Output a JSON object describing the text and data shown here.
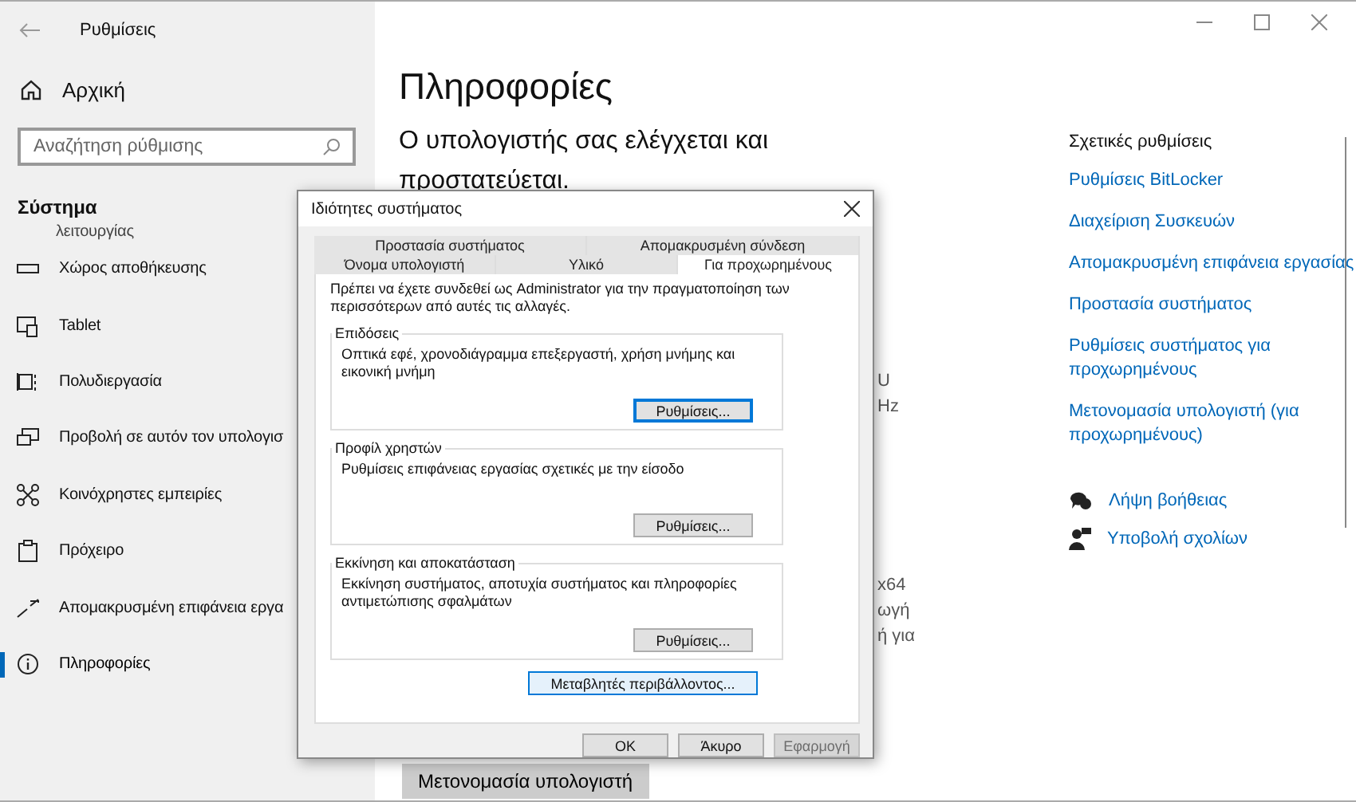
{
  "window": {
    "title": "Ρυθμίσεις"
  },
  "sidebar": {
    "home": "Αρχική",
    "search": {
      "placeholder": "Αναζήτηση ρύθμισης"
    },
    "section": "Σύστημα",
    "items": [
      {
        "label": "λειτουργίας",
        "kind": "cut",
        "selected": false
      },
      {
        "label": "Χώρος αποθήκευσης",
        "kind": "storage",
        "selected": false
      },
      {
        "label": "Tablet",
        "kind": "tablet",
        "selected": false
      },
      {
        "label": "Πολυδιεργασία",
        "kind": "multitask",
        "selected": false
      },
      {
        "label": "Προβολή σε αυτόν τον υπολογισ",
        "kind": "project",
        "selected": false
      },
      {
        "label": "Κοινόχρηστες εμπειρίες",
        "kind": "shared",
        "selected": false
      },
      {
        "label": "Πρόχειρο",
        "kind": "clipboard",
        "selected": false
      },
      {
        "label": "Απομακρυσμένη επιφάνεια εργα",
        "kind": "remote",
        "selected": false
      },
      {
        "label": "Πληροφορίες",
        "kind": "info",
        "selected": true
      }
    ]
  },
  "main": {
    "heading": "Πληροφορίες",
    "status": "Ο υπολογιστής σας ελέγχεται και προστατεύεται.",
    "fragments": [
      "U",
      "Hz",
      "x64",
      "ωγή",
      "ή για"
    ],
    "rename_button": "Μετονομασία υπολογιστή"
  },
  "related": {
    "title": "Σχετικές ρυθμίσεις",
    "links": [
      "Ρυθμίσεις BitLocker",
      "Διαχείριση Συσκευών",
      "Απομακρυσμένη επιφάνεια εργασίας",
      "Προστασία συστήματος",
      "Ρυθμίσεις συστήματος για προχωρημένους",
      "Μετονομασία υπολογιστή (για προχωρημένους)"
    ],
    "help": [
      {
        "label": "Λήψη βοήθειας",
        "kind": "help"
      },
      {
        "label": "Υποβολή σχολίων",
        "kind": "feedback"
      }
    ]
  },
  "dialog": {
    "title": "Ιδιότητες συστήματος",
    "tab_rows": [
      [
        {
          "label": "Προστασία συστήματος",
          "selected": false
        },
        {
          "label": "Απομακρυσμένη σύνδεση",
          "selected": false
        }
      ],
      [
        {
          "label": "Όνομα υπολογιστή",
          "selected": false
        },
        {
          "label": "Υλικό",
          "selected": false
        },
        {
          "label": "Για προχωρημένους",
          "selected": true
        }
      ]
    ],
    "intro": "Πρέπει να έχετε συνδεθεί ως Administrator για την πραγματοποίηση των περισσότερων από αυτές τις αλλαγές.",
    "groups": [
      {
        "title": "Επιδόσεις",
        "text": "Οπτικά εφέ, χρονοδιάγραμμα επεξεργαστή, χρήση μνήμης και εικονική μνήμη",
        "button": "Ρυθμίσεις...",
        "focused": true
      },
      {
        "title": "Προφίλ χρηστών",
        "text": "Ρυθμίσεις επιφάνειας εργασίας σχετικές με την είσοδο",
        "button": "Ρυθμίσεις...",
        "focused": false
      },
      {
        "title": "Εκκίνηση και αποκατάσταση",
        "text": "Εκκίνηση συστήματος, αποτυχία συστήματος και πληροφορίες αντιμετώπισης σφαλμάτων",
        "button": "Ρυθμίσεις...",
        "focused": false
      }
    ],
    "env_button": "Μεταβλητές περιβάλλοντος...",
    "buttons": [
      {
        "label": "OK",
        "disabled": false
      },
      {
        "label": "Άκυρο",
        "disabled": false
      },
      {
        "label": "Εφαρμογή",
        "disabled": true
      }
    ]
  }
}
